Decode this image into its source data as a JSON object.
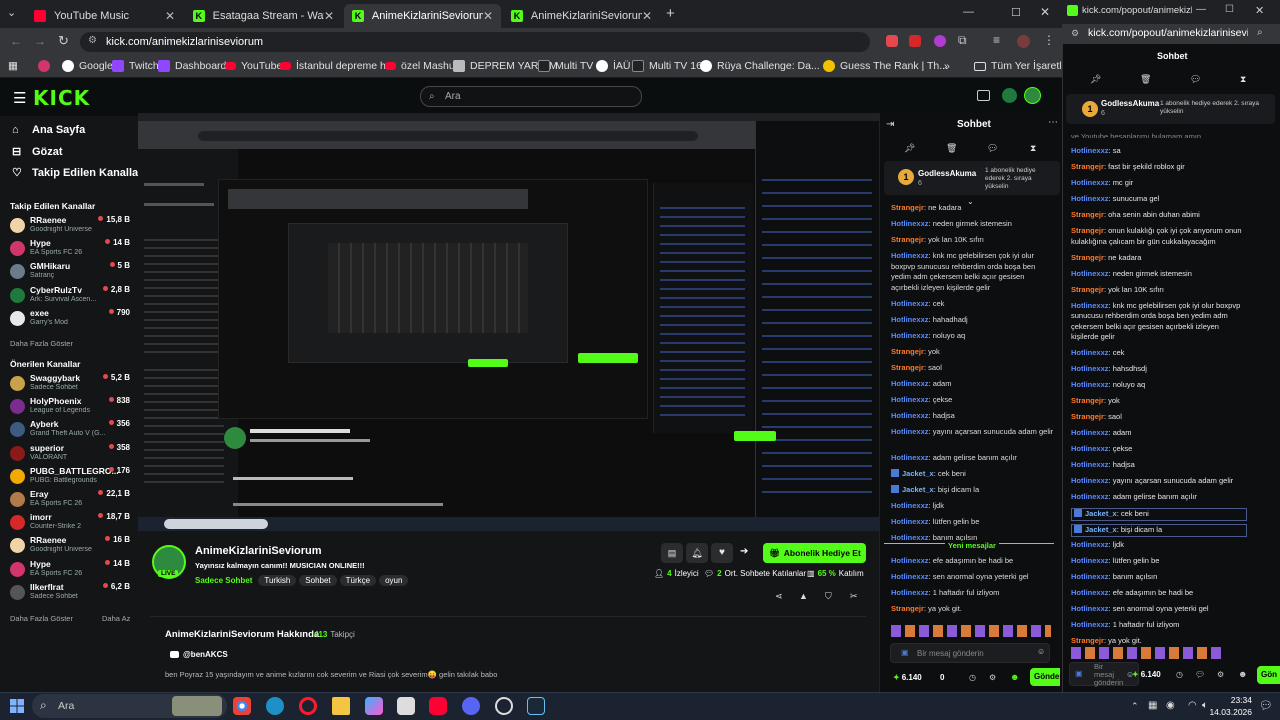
{
  "main_browser": {
    "tabs": [
      {
        "label": "YouTube Music",
        "color": "#ff0033",
        "active": false
      },
      {
        "label": "Esatagaa Stream - Watch Live o",
        "color": "#53fc18",
        "active": false
      },
      {
        "label": "AnimeKizlariniSeviorum Stream",
        "color": "#53fc18",
        "active": true
      },
      {
        "label": "AnimeKizlariniSeviorum Stream",
        "color": "#53fc18",
        "active": false
      }
    ],
    "url": "kick.com/animekizlariniseviorum",
    "bookmarks": [
      "Google",
      "Twitch",
      "Dashboard",
      "YouTube",
      "İstanbul depreme h...",
      "özel Mashup",
      "DEPREM YARDIM",
      "Multi TV",
      "İAÜ",
      "Multi TV 16",
      "Rüya Challenge: Da...",
      "Guess The Rank | Th..."
    ],
    "all_bookmarks": "Tüm Yer İşaretleri"
  },
  "kick": {
    "logo": "KICK",
    "search_placeholder": "Ara",
    "nav": [
      "Ana Sayfa",
      "Gözat",
      "Takip Edilen Kanallar"
    ],
    "followed_header": "Takip Edilen Kanallar",
    "followed": [
      {
        "name": "RRaenee",
        "game": "Goodnight Universe",
        "viewers": "15,8 B",
        "color": "#f1d3a8"
      },
      {
        "name": "Hype",
        "game": "EA Sports FC 26",
        "viewers": "14 B",
        "color": "#d1356a"
      },
      {
        "name": "GMHikaru",
        "game": "Satranç",
        "viewers": "5 B",
        "color": "#6b7b8c"
      },
      {
        "name": "CyberRulzTv",
        "game": "Ark: Survival Ascen...",
        "viewers": "2,8 B",
        "color": "#1f7a3e"
      },
      {
        "name": "exee",
        "game": "Garry's Mod",
        "viewers": "790",
        "color": "#e8e8e8"
      }
    ],
    "show_more": "Daha Fazla Göster",
    "recommended_header": "Önerilen Kanallar",
    "recommended": [
      {
        "name": "Swaggybark",
        "game": "Sadece Sohbet",
        "viewers": "5,2 B",
        "color": "#c9a14a"
      },
      {
        "name": "HolyPhoenix",
        "game": "League of Legends",
        "viewers": "838",
        "color": "#7a2d8f"
      },
      {
        "name": "Ayberk",
        "game": "Grand Theft Auto V (G...",
        "viewers": "356",
        "color": "#3d5a80"
      },
      {
        "name": "superior",
        "game": "VALORANT",
        "viewers": "358",
        "color": "#8b1a1a"
      },
      {
        "name": "PUBG_BATTLEGRO...",
        "game": "PUBG: Battlegrounds",
        "viewers": "176",
        "color": "#f2a900"
      },
      {
        "name": "Eray",
        "game": "EA Sports FC 26",
        "viewers": "22,1 B",
        "color": "#b07a4a"
      },
      {
        "name": "imorr",
        "game": "Counter-Strike 2",
        "viewers": "18,7 B",
        "color": "#d62828"
      },
      {
        "name": "RRaenee",
        "game": "Goodnight Universe",
        "viewers": "16 B",
        "color": "#f1d3a8"
      },
      {
        "name": "Hype",
        "game": "EA Sports FC 26",
        "viewers": "14 B",
        "color": "#d1356a"
      },
      {
        "name": "Ilkerflrat",
        "game": "Sadece Sohbet",
        "viewers": "6,2 B",
        "color": "#555"
      }
    ],
    "show_more2": "Daha Fazla Göster",
    "show_less": "Daha Az"
  },
  "stream": {
    "channel": "AnimeKizlariniSeviorum",
    "title": "Yayınsız kalmayın canım!! MUSICIAN ONLINE!!!",
    "category": "Sadece Sohbet",
    "tags": [
      "Turkish",
      "Sohbet",
      "Türkçe",
      "oyun"
    ],
    "live": "LIVE",
    "viewers": "4",
    "viewers_label": "İzleyici",
    "avg": "2",
    "avg_label": "Ort. Sohbete Katılanlar",
    "engage": "65 %",
    "engage_label": "Katılım",
    "gift_button": "Abonelik Hediye Et",
    "about_title": "AnimeKizlariniSeviorum Hakkında",
    "followers": "413",
    "followers_label": "Takipçi",
    "social": "@benAKCS",
    "bio": "ben Poyraz 15 yaşındayım ve anime kızlarını cok severim ve Riasi çok severim😛 gelin takılak babo"
  },
  "main_chat": {
    "title": "Sohbet",
    "pinned_user": "GodlessAkuma",
    "pinned_text": "1 abonelik hediye ederek 2. sıraya yükselin",
    "pinned_count": "6",
    "messages": [
      {
        "user": "Strangejr",
        "text": "ne kadara",
        "c": "sg"
      },
      {
        "user": "Hotlinexxz",
        "text": "neden girmek istemesin",
        "c": "hn"
      },
      {
        "user": "Strangejr",
        "text": "yok lan 10K sıfırı",
        "c": "sg"
      },
      {
        "user": "Hotlinexxz",
        "text": "knk mc gelebilirsen çok iyi olur boxpvp sunucusu rehberdim orda boşa ben yedim adm çekersem belki açıır gesisen açırbekli izleyen kişilerde gelir",
        "c": "hn"
      },
      {
        "user": "Hotlinexxz",
        "text": "cek",
        "c": "hn"
      },
      {
        "user": "Hotlinexxz",
        "text": "hahadhadj",
        "c": "hn"
      },
      {
        "user": "Hotlinexxz",
        "text": "noluyo aq",
        "c": "hn"
      },
      {
        "user": "Strangejr",
        "text": "yok",
        "c": "sg"
      },
      {
        "user": "Strangejr",
        "text": "saol",
        "c": "sg"
      },
      {
        "user": "Hotlinexxz",
        "text": "adam",
        "c": "hn"
      },
      {
        "user": "Hotlinexxz",
        "text": "çekse",
        "c": "hn"
      },
      {
        "user": "Hotlinexxz",
        "text": "hadjsa",
        "c": "hn"
      },
      {
        "user": "Hotlinexxz",
        "text": "yayını açarsan sunucuda adam gelir",
        "c": "hn"
      },
      {
        "user": "Hotlinexxz",
        "text": "adam gelirse banım açılır",
        "c": "hn"
      },
      {
        "user": "Jacket_x",
        "text": "cek beni",
        "c": "jk"
      },
      {
        "user": "Jacket_x",
        "text": "bişi dicam la",
        "c": "jk"
      },
      {
        "user": "Hotlinexxz",
        "text": "ljdk",
        "c": "hn"
      },
      {
        "user": "Hotlinexxz",
        "text": "lütfen gelin be",
        "c": "hn"
      },
      {
        "user": "Hotlinexxz",
        "text": "banım açılsın",
        "c": "hn"
      }
    ],
    "new_messages": "Yeni mesajlar",
    "messages2": [
      {
        "user": "Hotlinexxz",
        "text": "efe adaşımın be hadi be",
        "c": "hn"
      },
      {
        "user": "Hotlinexxz",
        "text": "sen anormal oyna yeterki gel",
        "c": "hn"
      },
      {
        "user": "Hotlinexxz",
        "text": "1 haftadır ful izliyom",
        "c": "hn"
      },
      {
        "user": "Strangejr",
        "text": "ya yok git.",
        "c": "sg"
      }
    ],
    "input_placeholder": "Bir mesaj gönderin",
    "points": "6.140",
    "zero": "0",
    "send": "Gönder"
  },
  "popout": {
    "title": "kick.com/popout/animekizlarinis...",
    "url": "kick.com/popout/animekizlariniseviorum",
    "chat_title": "Sohbet",
    "pinned_user": "GodlessAkuma",
    "pinned_text": "1 abonelik hediye ederek 2. sıraya yükselin",
    "pinned_count": "6",
    "partial": "ve Youtube hesaplarımı bulamam amın..",
    "messages": [
      {
        "user": "Hotlinexxz",
        "text": "sa",
        "c": "hn"
      },
      {
        "user": "Strangejr",
        "text": "fast bir şekild roblox gir",
        "c": "sg"
      },
      {
        "user": "Hotlinexxz",
        "text": "mc gir",
        "c": "hn"
      },
      {
        "user": "Hotlinexxz",
        "text": "sunucuma gel",
        "c": "hn"
      },
      {
        "user": "Strangejr",
        "text": "oha senin abin duhan abimi",
        "c": "sg"
      },
      {
        "user": "Strangejr",
        "text": "onun kulaklığı çok iyi çok arıyorum onun kulaklığına çalıcam bir gün cukkalayacağım",
        "c": "sg"
      },
      {
        "user": "Strangejr",
        "text": "ne kadara",
        "c": "sg"
      },
      {
        "user": "Hotlinexxz",
        "text": "neden girmek istemesin",
        "c": "hn"
      },
      {
        "user": "Strangejr",
        "text": "yok lan 10K sıfırı",
        "c": "sg"
      },
      {
        "user": "Hotlinexxz",
        "text": "knk mc gelebilirsen çok iyi olur boxpvp sunucusu rehberdim orda boşa ben yedim adm çekersem belki açır gesisen açırbekli izleyen kişilerde gelir",
        "c": "hn"
      },
      {
        "user": "Hotlinexxz",
        "text": "cek",
        "c": "hn"
      },
      {
        "user": "Hotlinexxz",
        "text": "hahsdhsdj",
        "c": "hn"
      },
      {
        "user": "Hotlinexxz",
        "text": "noluyo aq",
        "c": "hn"
      },
      {
        "user": "Strangejr",
        "text": "yok",
        "c": "sg"
      },
      {
        "user": "Strangejr",
        "text": "saol",
        "c": "sg"
      },
      {
        "user": "Hotlinexxz",
        "text": "adam",
        "c": "hn"
      },
      {
        "user": "Hotlinexxz",
        "text": "çekse",
        "c": "hn"
      },
      {
        "user": "Hotlinexxz",
        "text": "hadjsa",
        "c": "hn"
      },
      {
        "user": "Hotlinexxz",
        "text": "yayını açarsan sunucuda adam gelir",
        "c": "hn"
      },
      {
        "user": "Hotlinexxz",
        "text": "adam gelirse banım açılır",
        "c": "hn"
      },
      {
        "user": "Jacket_x",
        "text": "cek beni",
        "c": "jk"
      },
      {
        "user": "Jacket_x",
        "text": "bişi dicam la",
        "c": "jk"
      },
      {
        "user": "Hotlinexxz",
        "text": "ljdk",
        "c": "hn"
      },
      {
        "user": "Hotlinexxz",
        "text": "lütfen gelin be",
        "c": "hn"
      },
      {
        "user": "Hotlinexxz",
        "text": "banım açılsın",
        "c": "hn"
      },
      {
        "user": "Hotlinexxz",
        "text": "efe adaşımın be hadi be",
        "c": "hn"
      },
      {
        "user": "Hotlinexxz",
        "text": "sen anormal oyna yeterki gel",
        "c": "hn"
      },
      {
        "user": "Hotlinexxz",
        "text": "1 haftadır ful izliyom",
        "c": "hn"
      },
      {
        "user": "Strangejr",
        "text": "ya yok git.",
        "c": "sg"
      }
    ],
    "input_placeholder": "Bir mesaj gönderin",
    "points": "6.140",
    "send": "Gön"
  },
  "taskbar": {
    "search": "Ara",
    "time": "23:34",
    "date": "14.03.2026"
  }
}
